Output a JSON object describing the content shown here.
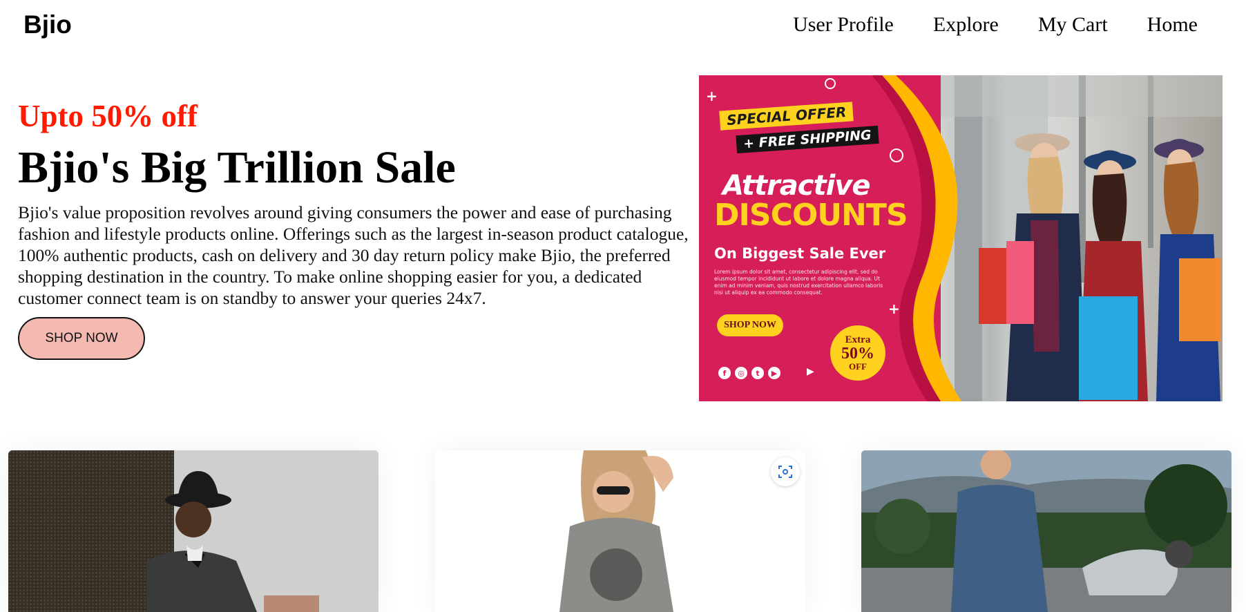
{
  "nav": {
    "logo": "Bjio",
    "links": [
      "User Profile",
      "Explore",
      "My Cart",
      "Home"
    ]
  },
  "hero": {
    "kicker": "Upto 50% off",
    "title": "Bjio's Big Trillion Sale",
    "description": "Bjio's value proposition revolves around giving consumers the power and ease of purchasing fashion and lifestyle products online. Offerings such as the largest in-season product catalogue, 100% authentic products, cash on delivery and 30 day return policy make Bjio, the preferred shopping destination in the country. To make online shopping easier for you, a dedicated customer connect team is on standby to answer your queries 24x7.",
    "button": "SHOP NOW"
  },
  "banner": {
    "special_offer": "SPECIAL OFFER",
    "free_shipping": "+ FREE SHIPPING",
    "attractive": "Attractive",
    "discounts": "DISCOUNTS",
    "biggest_sale": "On Biggest Sale Ever",
    "lorem": "Lorem ipsum dolor sit amet, consectetur adipiscing elit, sed do eiusmod tempor incididunt ut labore et dolore magna aliqua. Ut enim ad minim veniam, quis nostrud exercitation ullamco laboris nisi ut aliquip ex ea commodo consequat.",
    "shop_now": "SHOP NOW",
    "extra_1": "Extra",
    "extra_2": "50%",
    "extra_3": "OFF",
    "social_icons": [
      "facebook-icon",
      "instagram-icon",
      "twitter-icon",
      "youtube-icon"
    ],
    "colors": {
      "pink": "#d61f59",
      "yellow": "#ffd21f"
    }
  },
  "cards": [
    {
      "image": "man-in-black-hat-photo"
    },
    {
      "image": "woman-in-grey-tshirt-photo",
      "action_icon": "visual-search-icon"
    },
    {
      "image": "man-with-motorcycle-photo"
    }
  ],
  "colors": {
    "kicker": "#ff1a00",
    "button_bg": "#f4b9b1"
  }
}
